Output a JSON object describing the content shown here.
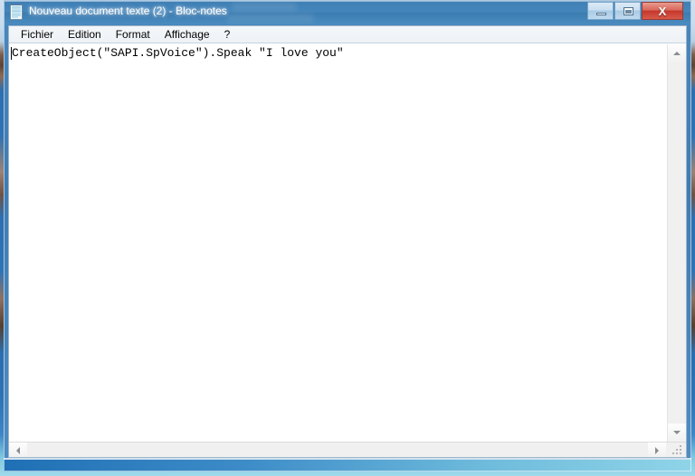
{
  "window": {
    "title": "Nouveau document texte (2) - Bloc-notes",
    "icon": "notepad-icon",
    "controls": {
      "minimize_label": "–",
      "maximize_label": "□",
      "close_label": "X"
    }
  },
  "menu": {
    "items": [
      {
        "label": "Fichier",
        "name": "menu-fichier"
      },
      {
        "label": "Edition",
        "name": "menu-edition"
      },
      {
        "label": "Format",
        "name": "menu-format"
      },
      {
        "label": "Affichage",
        "name": "menu-affichage"
      },
      {
        "label": "?",
        "name": "menu-aide"
      }
    ]
  },
  "editor": {
    "content": "CreateObject(\"SAPI.SpVoice\").Speak \"I love you\"",
    "caret_position": 0,
    "word_wrap": false
  },
  "scrollbars": {
    "vertical": {
      "up_arrow": "scroll-up-icon",
      "down_arrow": "scroll-down-icon"
    },
    "horizontal": {
      "left_arrow": "scroll-left-icon",
      "right_arrow": "scroll-right-icon"
    },
    "size_grip": "resize-grip-icon"
  },
  "colors": {
    "titlebar_blue": "#4486bb",
    "close_red": "#c4382c",
    "client_bg": "#f0f0f0",
    "editor_bg": "#ffffff",
    "frame_bottom_start": "#1f6fb5",
    "frame_bottom_end": "#8fd4e8"
  }
}
